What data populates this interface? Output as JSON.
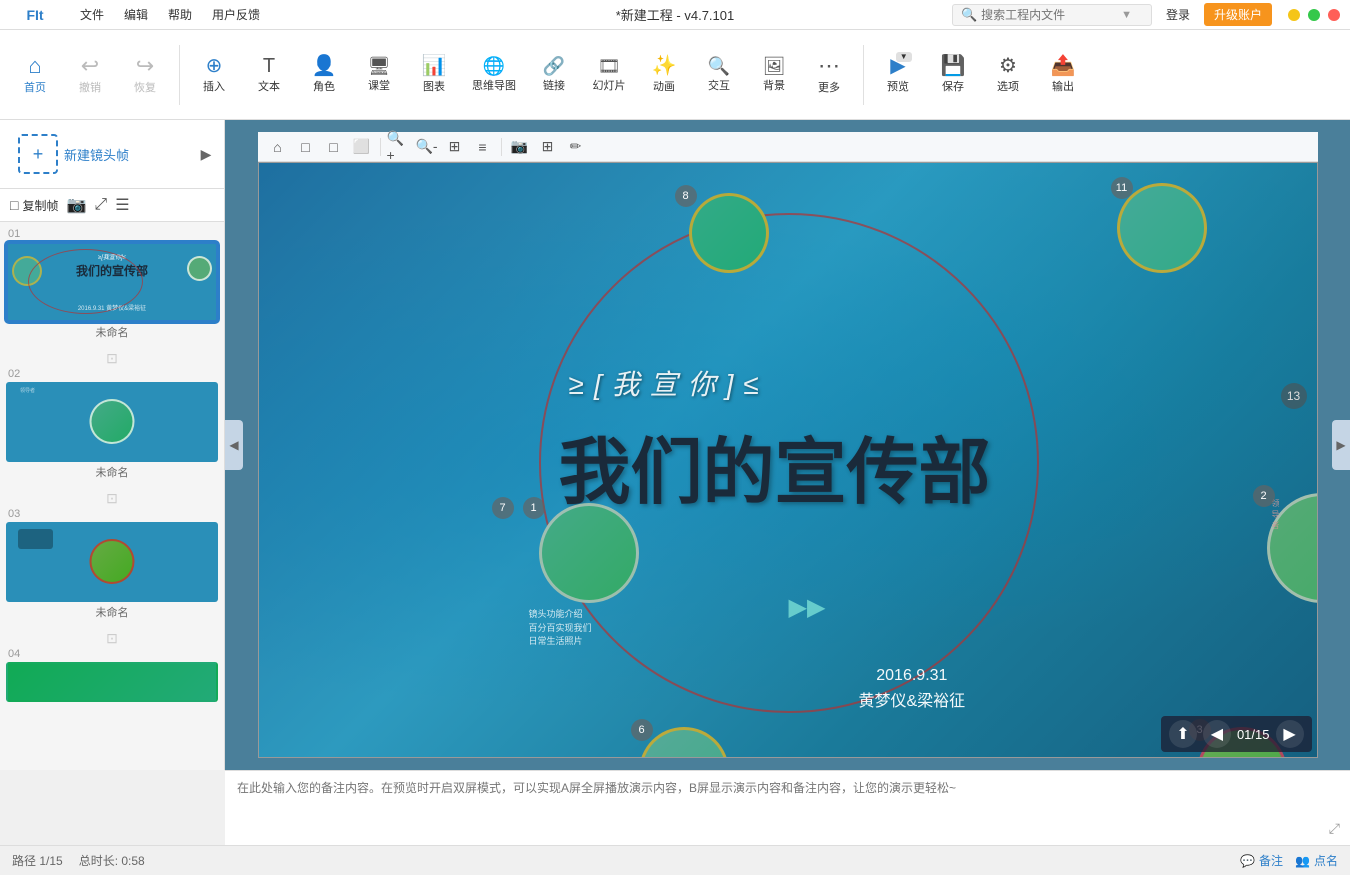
{
  "titlebar": {
    "logo": "FIt",
    "menus": [
      "文件",
      "编辑",
      "帮助",
      "用户反馈"
    ],
    "title": "*新建工程 - v4.7.101",
    "search_placeholder": "搜索工程内文件",
    "login_label": "登录",
    "upgrade_label": "升级账户"
  },
  "toolbar": {
    "items": [
      {
        "id": "home",
        "icon": "⌂",
        "label": "首页"
      },
      {
        "id": "undo",
        "icon": "↩",
        "label": "撤销"
      },
      {
        "id": "redo",
        "icon": "↪",
        "label": "恢复"
      },
      {
        "id": "insert",
        "icon": "⊕",
        "label": "插入"
      },
      {
        "id": "text",
        "icon": "T",
        "label": "文本"
      },
      {
        "id": "role",
        "icon": "👤",
        "label": "角色"
      },
      {
        "id": "class",
        "icon": "🖥",
        "label": "课堂"
      },
      {
        "id": "chart",
        "icon": "📊",
        "label": "图表"
      },
      {
        "id": "mindmap",
        "icon": "🌐",
        "label": "思维导图"
      },
      {
        "id": "link",
        "icon": "🔗",
        "label": "链接"
      },
      {
        "id": "slide",
        "icon": "🎞",
        "label": "幻灯片"
      },
      {
        "id": "anim",
        "icon": "✨",
        "label": "动画"
      },
      {
        "id": "interact",
        "icon": "🔍",
        "label": "交互"
      },
      {
        "id": "bg",
        "icon": "🖼",
        "label": "背景"
      },
      {
        "id": "more",
        "icon": "⋯",
        "label": "更多"
      },
      {
        "id": "preview",
        "icon": "▶",
        "label": "预览"
      },
      {
        "id": "save",
        "icon": "💾",
        "label": "保存"
      },
      {
        "id": "options",
        "icon": "⚙",
        "label": "选项"
      },
      {
        "id": "export",
        "icon": "📤",
        "label": "输出"
      }
    ]
  },
  "slides": [
    {
      "num": "01",
      "name": "未命名",
      "active": true
    },
    {
      "num": "02",
      "name": "未命名",
      "active": false
    },
    {
      "num": "03",
      "name": "未命名",
      "active": false
    },
    {
      "num": "04",
      "name": "",
      "active": false
    }
  ],
  "new_scene_label": "新建镜头帧",
  "canvas": {
    "title_decoration": "≥[我宣你]≤",
    "main_title": "我们的宣传部",
    "date": "2016.9.31",
    "author": "黄梦仪&梁裕征",
    "num_badges": [
      "8",
      "11",
      "13",
      "7",
      "1",
      "2",
      "6",
      "3"
    ],
    "slide_badges": [
      "8",
      "11",
      "13",
      "6",
      "3"
    ]
  },
  "notes": {
    "placeholder": "在此处输入您的备注内容。在预览时开启双屏模式，可以实现A屏全屏播放演示内容，B屏显示演示内容和备注内容，让您的演示更轻松~"
  },
  "statusbar": {
    "path": "路径 1/15",
    "duration": "总时长: 0:58",
    "comment_label": "备注",
    "point_label": "点名"
  },
  "playback": {
    "current": "01",
    "total": "15"
  }
}
